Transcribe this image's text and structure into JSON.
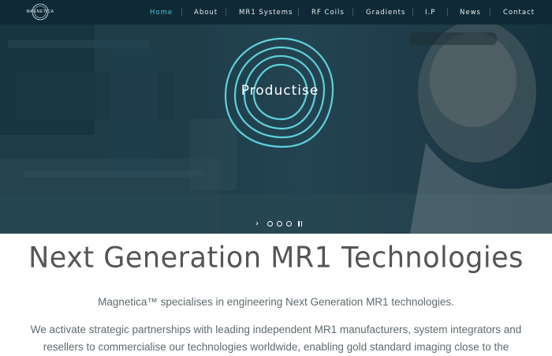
{
  "brand": {
    "logo_text": "MAGNETICA",
    "accent_color": "#4ec1d0",
    "nav_background": "#0f2a36"
  },
  "nav": {
    "items": [
      {
        "label": "Home",
        "active": true
      },
      {
        "label": "About",
        "active": false
      },
      {
        "label": "MR1 Systems",
        "active": false
      },
      {
        "label": "RF Coils",
        "active": false
      },
      {
        "label": "Gradients",
        "active": false
      },
      {
        "label": "I.P",
        "active": false
      },
      {
        "label": "News",
        "active": false
      },
      {
        "label": "Contact",
        "active": false
      }
    ]
  },
  "hero": {
    "slide_word": "Productise",
    "slide_count": 3,
    "controls": {
      "next_icon": "chevron-right-icon",
      "pause_icon": "pause-icon"
    }
  },
  "content": {
    "headline": "Next Generation MR1 Technologies",
    "intro": "Magnetica™ specialises in engineering Next Generation MR1 technologies.",
    "body": "We activate strategic partnerships with leading independent MR1 manufacturers, system integrators and resellers to commercialise our technologies worldwide, enabling gold standard imaging close to the"
  }
}
